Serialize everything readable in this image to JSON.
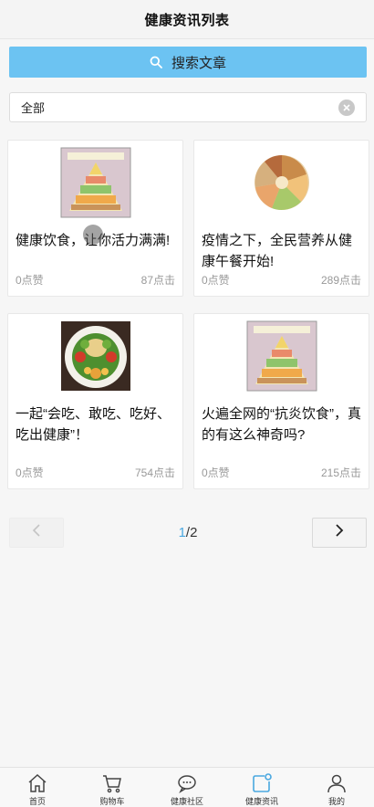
{
  "header": {
    "title": "健康资讯列表"
  },
  "search": {
    "button_label": "搜索文章",
    "icon": "search-icon"
  },
  "filter": {
    "value": "全部",
    "clear_icon": "clear-icon"
  },
  "articles": [
    {
      "title": "健康饮食，让你活力满满!",
      "likes": "0点赞",
      "clicks": "87点击",
      "image": "food-pyramid"
    },
    {
      "title": "疫情之下，全民营养从健康午餐开始!",
      "likes": "0点赞",
      "clicks": "289点击",
      "image": "food-platter"
    },
    {
      "title": "一起“会吃、敢吃、吃好、吃出健康”！",
      "likes": "0点赞",
      "clicks": "754点击",
      "image": "vegetable-plate"
    },
    {
      "title": "火遍全网的“抗炎饮食”，真的有这么神奇吗?",
      "likes": "0点赞",
      "clicks": "215点击",
      "image": "food-pyramid"
    }
  ],
  "pager": {
    "current": "1",
    "total": "/2"
  },
  "tabbar": [
    {
      "label": "首页",
      "icon": "home-icon"
    },
    {
      "label": "购物车",
      "icon": "cart-icon"
    },
    {
      "label": "健康社区",
      "icon": "chat-icon"
    },
    {
      "label": "健康资讯",
      "icon": "news-icon",
      "active": true
    },
    {
      "label": "我的",
      "icon": "user-icon"
    }
  ],
  "colors": {
    "accent": "#6cc3f2",
    "active_tab": "#4aa8e0",
    "page_current": "#4aa8e0"
  }
}
